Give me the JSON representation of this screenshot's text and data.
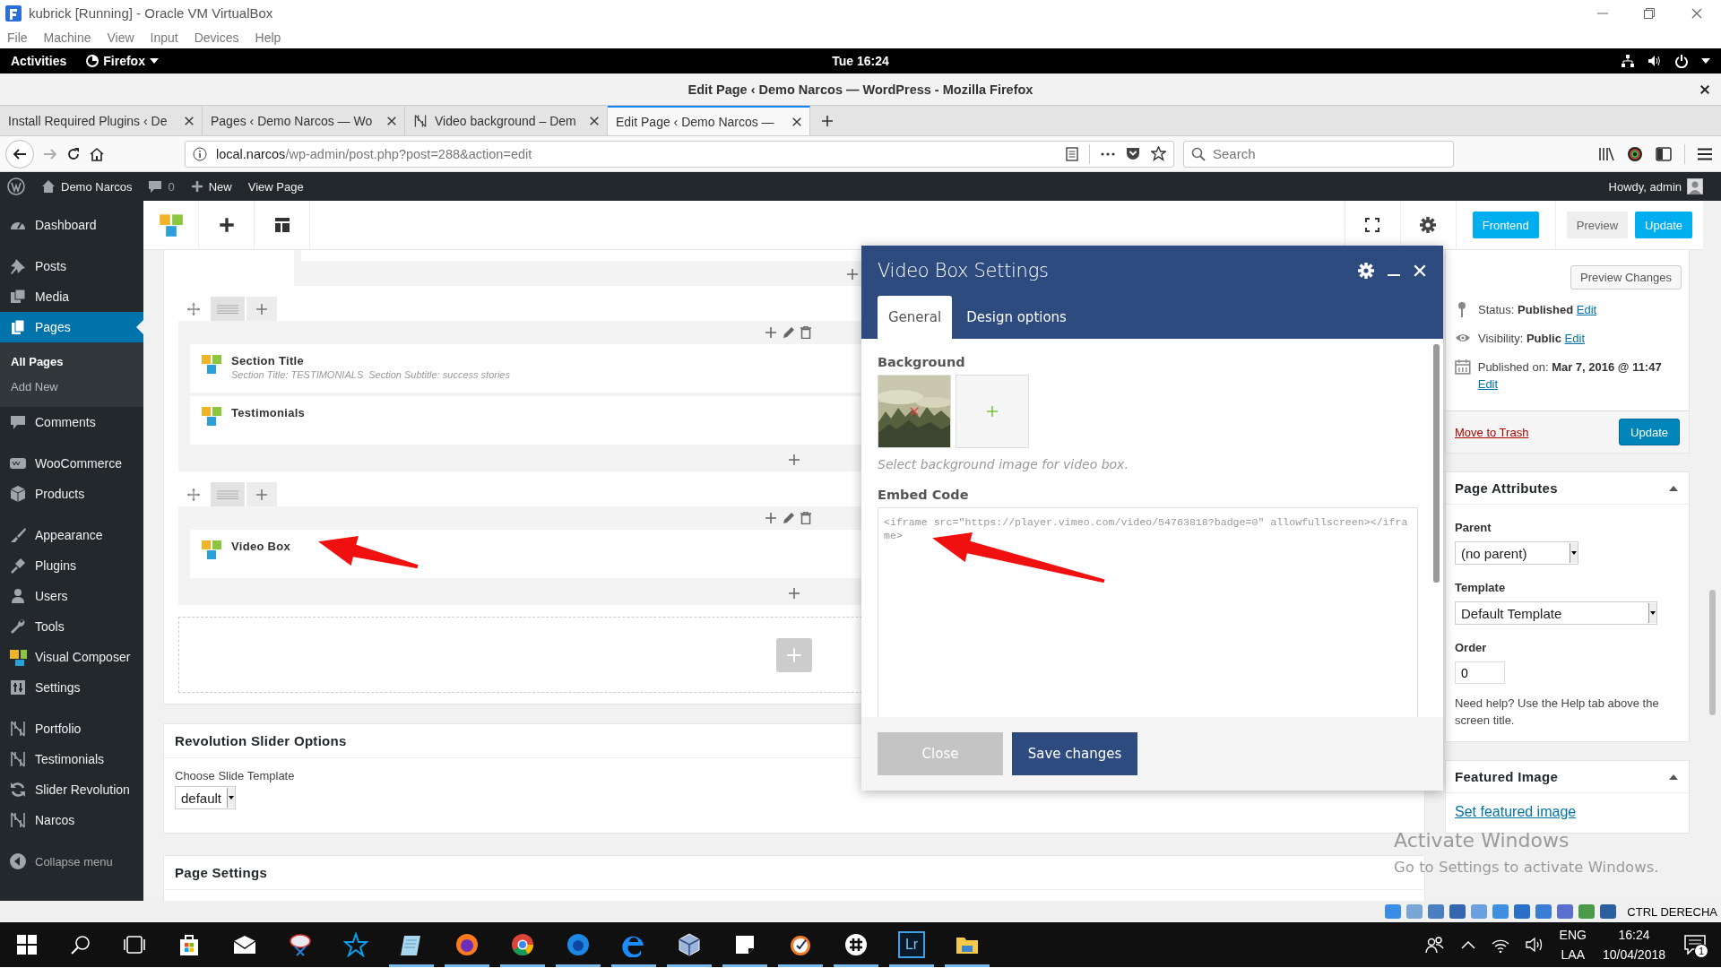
{
  "vbox": {
    "title": "kubrick [Running] - Oracle VM VirtualBox",
    "menu": [
      "File",
      "Machine",
      "View",
      "Input",
      "Devices",
      "Help"
    ],
    "host_key": "CTRL DERECHA"
  },
  "desktop_bar": {
    "activities": "Activities",
    "app": "Firefox",
    "clock": "Tue 16:24"
  },
  "browser": {
    "title": "Edit Page ‹ Demo Narcos — WordPress - Mozilla Firefox",
    "tabs": [
      {
        "label": "Install Required Plugins ‹ De",
        "selected": false,
        "kind": "plain"
      },
      {
        "label": "Pages ‹ Demo Narcos — Wo",
        "selected": false,
        "kind": "plain"
      },
      {
        "label": "Video background – Dem",
        "selected": false,
        "kind": "site"
      },
      {
        "label": "Edit Page ‹ Demo Narcos —",
        "selected": true,
        "kind": "plain"
      }
    ],
    "can_go_forward": false,
    "url": {
      "host": "local.narcos",
      "path": "/wp-admin/post.php?post=288&action=edit"
    },
    "search": {
      "placeholder": "Search"
    }
  },
  "admin_bar": {
    "site": "Demo Narcos",
    "comments": "0",
    "new": "New",
    "view": "View Page",
    "greeting": "Howdy, admin"
  },
  "sidebar": {
    "groups": [
      [
        {
          "label": "Dashboard",
          "selected": false
        }
      ],
      [
        {
          "label": "Posts",
          "selected": false
        },
        {
          "label": "Media",
          "selected": false
        },
        {
          "label": "Pages",
          "selected": true,
          "children": [
            {
              "label": "All Pages",
              "selected": true
            },
            {
              "label": "Add New",
              "selected": false
            }
          ]
        },
        {
          "label": "Comments",
          "selected": false
        }
      ],
      [
        {
          "label": "WooCommerce",
          "selected": false
        },
        {
          "label": "Products",
          "selected": false
        }
      ],
      [
        {
          "label": "Appearance",
          "selected": false
        },
        {
          "label": "Plugins",
          "selected": false
        },
        {
          "label": "Users",
          "selected": false
        },
        {
          "label": "Tools",
          "selected": false
        },
        {
          "label": "Visual Composer",
          "selected": false
        },
        {
          "label": "Settings",
          "selected": false
        }
      ],
      [
        {
          "label": "Portfolio",
          "selected": false
        },
        {
          "label": "Testimonials",
          "selected": false
        },
        {
          "label": "Slider Revolution",
          "selected": false
        },
        {
          "label": "Narcos",
          "selected": false
        }
      ]
    ],
    "collapse": "Collapse menu"
  },
  "builder": {
    "toolbar_buttons": [
      {
        "label": "Frontend",
        "kind": "primary"
      },
      {
        "label": "Preview",
        "kind": "secondary"
      },
      {
        "label": "Update",
        "kind": "primary"
      }
    ],
    "rows": [
      {
        "elements": [
          {
            "title": "Section Title",
            "params": [
              "Section Title: TESTIMONIALS",
              "Section Subtitle: success stories"
            ]
          },
          {
            "title": "Testimonials"
          }
        ]
      },
      {
        "elements": [
          {
            "title": "Video Box"
          }
        ]
      }
    ]
  },
  "panels": [
    {
      "title": "Revolution Slider Options",
      "field": {
        "label": "Choose Slide Template",
        "value": "default"
      }
    },
    {
      "title": "Page Settings"
    }
  ],
  "publish": {
    "preview": "Preview Changes",
    "meta": [
      {
        "label": "Status:",
        "value": "Published",
        "link": "Edit"
      },
      {
        "label": "Visibility:",
        "value": "Public",
        "link": "Edit"
      },
      {
        "label": "Published on:",
        "value": "Mar 7, 2016 @ 11:47",
        "link": "Edit"
      }
    ],
    "trash": "Move to Trash",
    "update": "Update"
  },
  "page_attributes": {
    "title": "Page Attributes",
    "expanded": true,
    "parent": {
      "label": "Parent",
      "value": "(no parent)"
    },
    "template": {
      "label": "Template",
      "value": "Default Template"
    },
    "order": {
      "label": "Order",
      "value": "0"
    },
    "help": "Need help? Use the Help tab above the screen title."
  },
  "featured_image": {
    "title": "Featured Image",
    "expanded": true,
    "link": "Set featured image"
  },
  "modal": {
    "title": "Video Box Settings",
    "tabs": [
      {
        "label": "General",
        "selected": true
      },
      {
        "label": "Design options",
        "selected": false
      }
    ],
    "background": {
      "label": "Background",
      "hint": "Select background image for video box."
    },
    "embed": {
      "label": "Embed Code",
      "value": "<iframe src=\"https://player.vimeo.com/video/54763818?badge=0\" allowfullscreen></iframe>"
    },
    "buttons": [
      {
        "label": "Close",
        "kind": "secondary"
      },
      {
        "label": "Save changes",
        "kind": "primary"
      }
    ]
  },
  "activation_notice": {
    "title": "Activate Windows",
    "text": "Go to Settings to activate Windows."
  },
  "taskbar": {
    "apps": [
      {
        "running": false
      },
      {
        "running": false
      },
      {
        "running": false
      },
      {
        "running": false
      },
      {
        "running": true
      },
      {
        "running": true
      },
      {
        "running": true
      },
      {
        "running": true
      },
      {
        "running": true
      },
      {
        "running": true
      },
      {
        "running": true
      },
      {
        "running": true
      },
      {
        "running": true
      },
      {
        "running": true,
        "label": "Lr"
      },
      {
        "running": true
      }
    ],
    "tray": {
      "language": "ENG",
      "layout": "LAA",
      "time": "16:24",
      "date": "10/04/2018",
      "notifications": "1"
    }
  }
}
